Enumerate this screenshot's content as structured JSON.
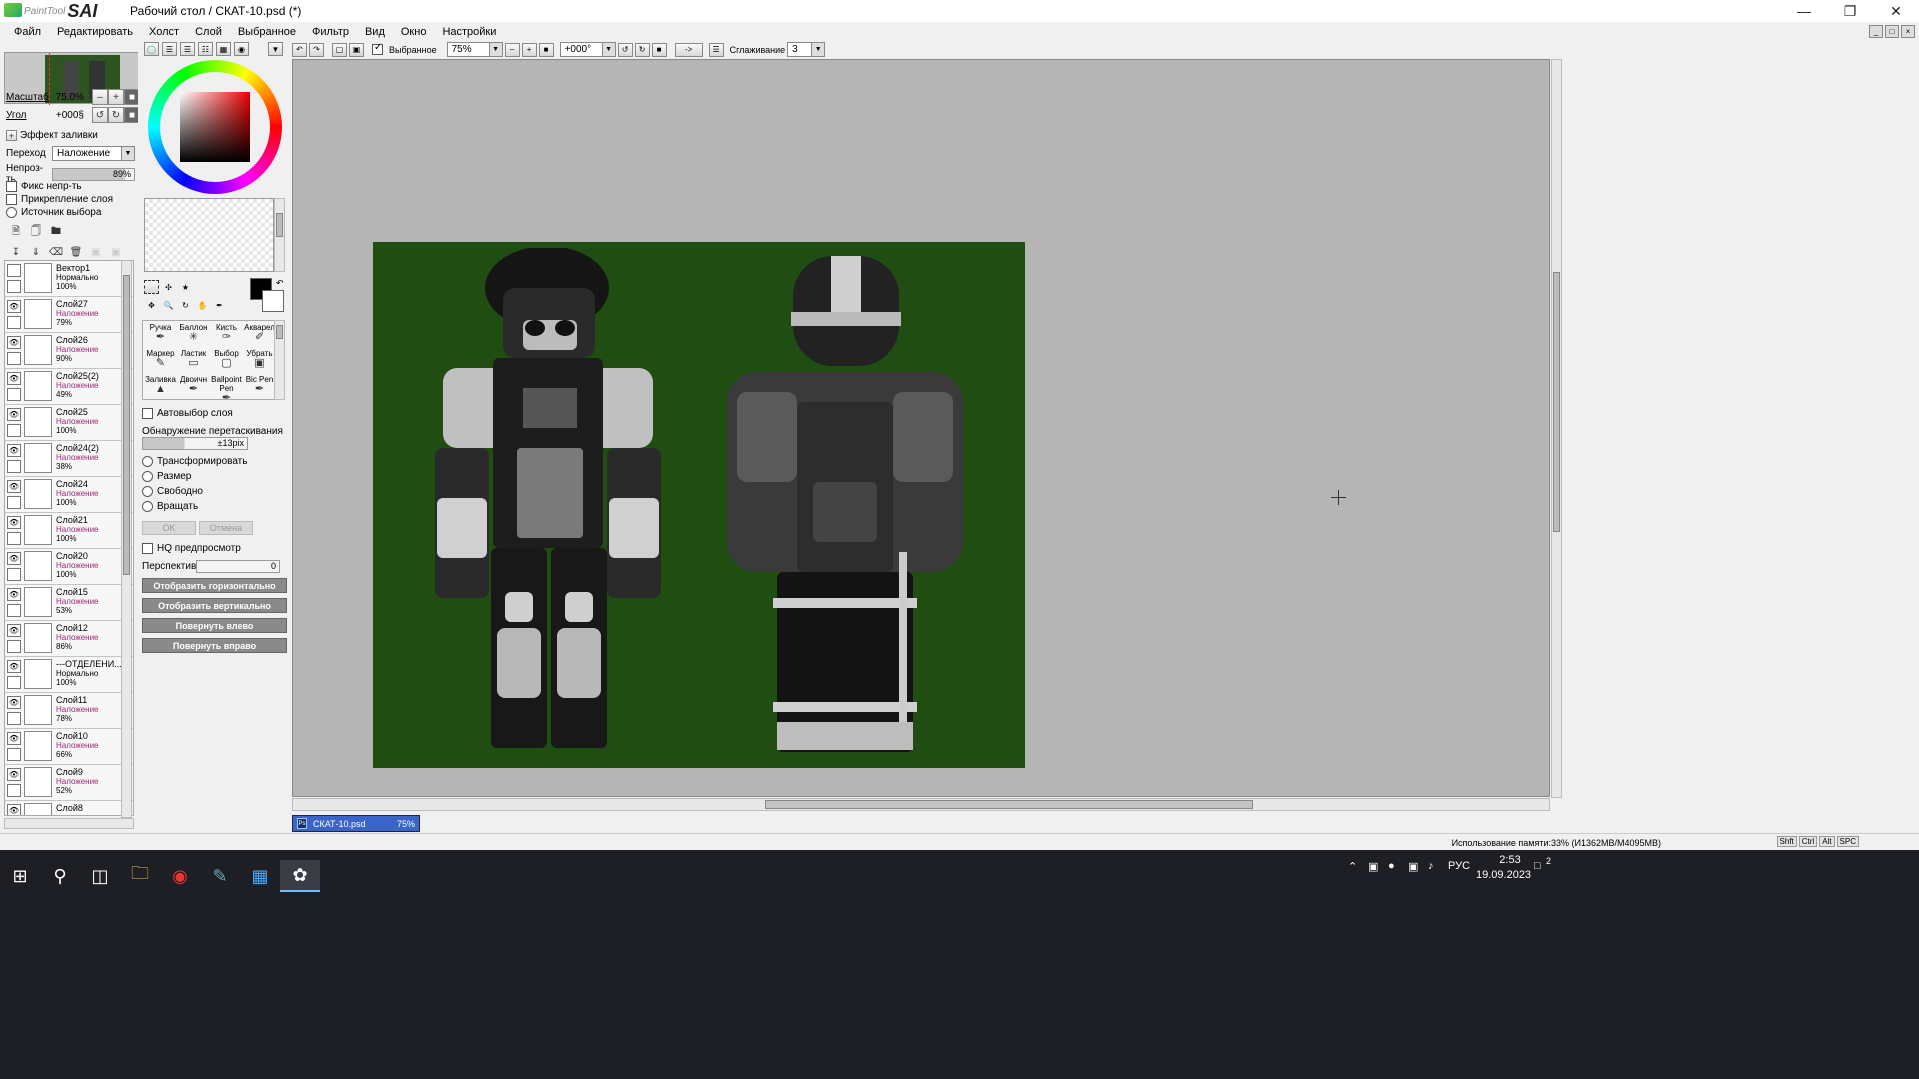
{
  "titlebar": {
    "logo_small": "PaintTool",
    "logo_big": "SAI",
    "title": "Рабочий стол / СКАТ-10.psd (*)"
  },
  "menu": [
    "Файл",
    "Редактировать",
    "Холст",
    "Слой",
    "Выбранное",
    "Фильтр",
    "Вид",
    "Окно",
    "Настройки"
  ],
  "navigator": {
    "zoom_label": "Масштаб",
    "zoom_value": "75.0%",
    "angle_label": "Угол",
    "angle_value": "+000§"
  },
  "layer_props": {
    "fill_effect": "Эффект заливки",
    "blend_label": "Переход",
    "blend_value": "Наложение",
    "opacity_label": "Непроз-ть",
    "opacity_value": "89%",
    "opacity_fraction": 0.89,
    "fix_opacity": "Фикс непр-ть",
    "clip_layer": "Прикрепление слоя",
    "selection_source": "Источник выбора"
  },
  "layers": [
    {
      "name": "Вектор1",
      "mode": "Нормально",
      "opacity": "100%",
      "visible": false
    },
    {
      "name": "Слой27",
      "mode": "Наложение",
      "opacity": "79%",
      "visible": true
    },
    {
      "name": "Слой26",
      "mode": "Наложение",
      "opacity": "90%",
      "visible": true
    },
    {
      "name": "Слой25(2)",
      "mode": "Наложение",
      "opacity": "49%",
      "visible": true
    },
    {
      "name": "Слой25",
      "mode": "Наложение",
      "opacity": "100%",
      "visible": true
    },
    {
      "name": "Слой24(2)",
      "mode": "Наложение",
      "opacity": "38%",
      "visible": true
    },
    {
      "name": "Слой24",
      "mode": "Наложение",
      "opacity": "100%",
      "visible": true
    },
    {
      "name": "Слой21",
      "mode": "Наложение",
      "opacity": "100%",
      "visible": true
    },
    {
      "name": "Слой20",
      "mode": "Наложение",
      "opacity": "100%",
      "visible": true
    },
    {
      "name": "Слой15",
      "mode": "Наложение",
      "opacity": "53%",
      "visible": true
    },
    {
      "name": "Слой12",
      "mode": "Наложение",
      "opacity": "86%",
      "visible": true
    },
    {
      "name": "---ОТДЕЛЕНИ...",
      "mode": "Нормально",
      "opacity": "100%",
      "visible": true
    },
    {
      "name": "Слой11",
      "mode": "Наложение",
      "opacity": "78%",
      "visible": true
    },
    {
      "name": "Слой10",
      "mode": "Наложение",
      "opacity": "66%",
      "visible": true
    },
    {
      "name": "Слой9",
      "mode": "Наложение",
      "opacity": "52%",
      "visible": true
    },
    {
      "name": "Слой8",
      "mode": "",
      "opacity": "",
      "visible": true
    }
  ],
  "tools": [
    {
      "label": "Ручка",
      "icon": "pen-icon"
    },
    {
      "label": "Баллон",
      "icon": "airbrush-icon"
    },
    {
      "label": "Кисть",
      "icon": "brush-icon"
    },
    {
      "label": "Акварел",
      "icon": "watercolor-icon"
    },
    {
      "label": "Маркер",
      "icon": "marker-icon"
    },
    {
      "label": "Ластик",
      "icon": "eraser-icon"
    },
    {
      "label": "Выбор",
      "icon": "select-icon"
    },
    {
      "label": "Убрать",
      "icon": "deselect-icon"
    },
    {
      "label": "Заливка",
      "icon": "fill-icon"
    },
    {
      "label": "Двоичн",
      "icon": "binary-icon"
    },
    {
      "label": "Ballpoint Pen",
      "icon": "ballpoint-icon"
    },
    {
      "label": "Bic Pen",
      "icon": "bic-pen-icon"
    }
  ],
  "transform": {
    "auto_select": "Автовыбор слоя",
    "drag_detect": "Обнаружение перетаскивания",
    "drag_value": "±13pix",
    "options": [
      "Трансформировать",
      "Размер",
      "Свободно",
      "Вращать"
    ],
    "ok": "OK",
    "cancel": "Отмена",
    "hq_preview": "HQ предпросмотр",
    "perspective_label": "Перспектива",
    "perspective_value": "0",
    "flip_h": "Отобразить горизонтально",
    "flip_v": "Отобразить вертикально",
    "rotate_left": "Повернуть влево",
    "rotate_right": "Повернуть вправо"
  },
  "canvas_toolbar": {
    "selection_label": "Выбранное",
    "zoom": "75%",
    "angle": "+000°",
    "arrow": "->",
    "smoothing_label": "Сглаживание",
    "smoothing_value": "3"
  },
  "document_tab": {
    "name": "СКАТ-10.psd",
    "zoom": "75%",
    "icon": "Ps"
  },
  "status": {
    "memory": "Использование памяти:33% (И1362MB/M4095MB)",
    "keys": [
      "Shft",
      "Ctrl",
      "Alt",
      "SPC"
    ]
  },
  "taskbar": {
    "lang": "РУС",
    "time": "2:53",
    "date": "19.09.2023",
    "notif_count": "2"
  },
  "colors": {
    "canvas_bg": "#b5b5b5",
    "artwork_bg": "#1f4d12",
    "layer_mode_color": "#a0287a",
    "taskbar_bg": "#1e1f25"
  }
}
